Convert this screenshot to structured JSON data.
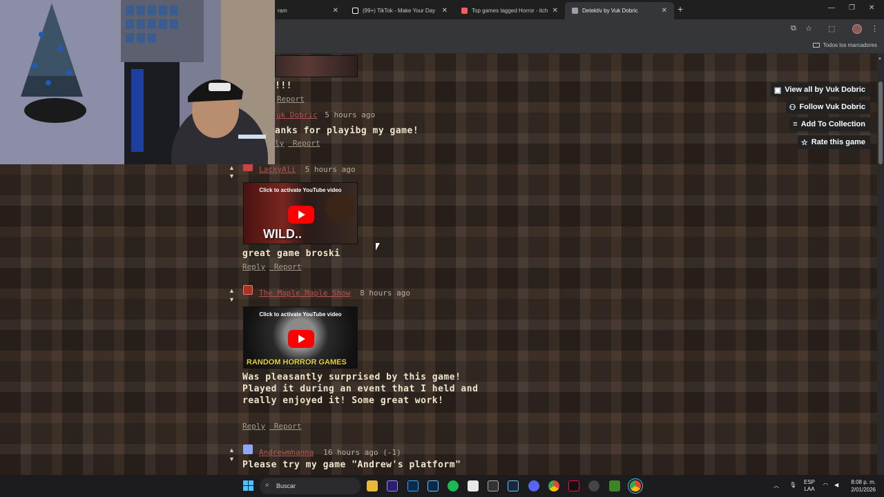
{
  "browser": {
    "tabs": [
      {
        "label": "ram",
        "favicon_color": "#d6249f",
        "active": false
      },
      {
        "label": "(99+) TikTok - Make Your Day",
        "favicon_color": "#ffffff",
        "active": false
      },
      {
        "label": "Top games tagged Horror - itch",
        "favicon_color": "#fa5c5c",
        "active": false
      },
      {
        "label": "Detektiv by Vuk Dobric",
        "favicon_color": "#9aa0a6",
        "active": true
      }
    ],
    "bookmarks_label": "Todos los marcadores"
  },
  "sidebar_actions": [
    {
      "label": "View all by Vuk Dobric",
      "icon": "gallery-icon"
    },
    {
      "label": "Follow Vuk Dobric",
      "icon": "follow-user-icon"
    },
    {
      "label": "Add To Collection",
      "icon": "playlist-add-icon"
    },
    {
      "label": "Rate this game",
      "icon": "star-icon"
    }
  ],
  "comments": {
    "partial_top_text": "!!!",
    "partial_top_actions": [
      "Report"
    ],
    "reply_author": "uk Dobric",
    "reply_time": "5 hours ago",
    "reply_text": "anks for playibg my game!",
    "reply_actions": [
      "ly",
      "Report"
    ],
    "c1": {
      "author": "LackyAli",
      "time": "5 hours ago",
      "video_caption": "Click to activate YouTube video",
      "video_overlay": "WILD..",
      "text": "great game broski",
      "actions": [
        "Reply",
        "Report"
      ]
    },
    "c2": {
      "author": "The Maple Maple Show",
      "time": "8 hours ago",
      "video_caption": "Click to activate YouTube video",
      "video_overlay": "RANDOM HORROR GAMES",
      "text": "Was pleasantly surprised by this game! Played it during an event that I held and really enjoyed it! Some great work!",
      "actions": [
        "Reply",
        "Report"
      ]
    },
    "c3": {
      "author": "Andrewmhanna",
      "time": "16 hours ago (-1)",
      "text": "Please try my game \"Andrew's platform\""
    }
  },
  "taskbar": {
    "search_placeholder": "Buscar",
    "lang_top": "ESP",
    "lang_bottom": "LAA",
    "time": "8:08 p. m.",
    "date": "2/01/2026"
  }
}
